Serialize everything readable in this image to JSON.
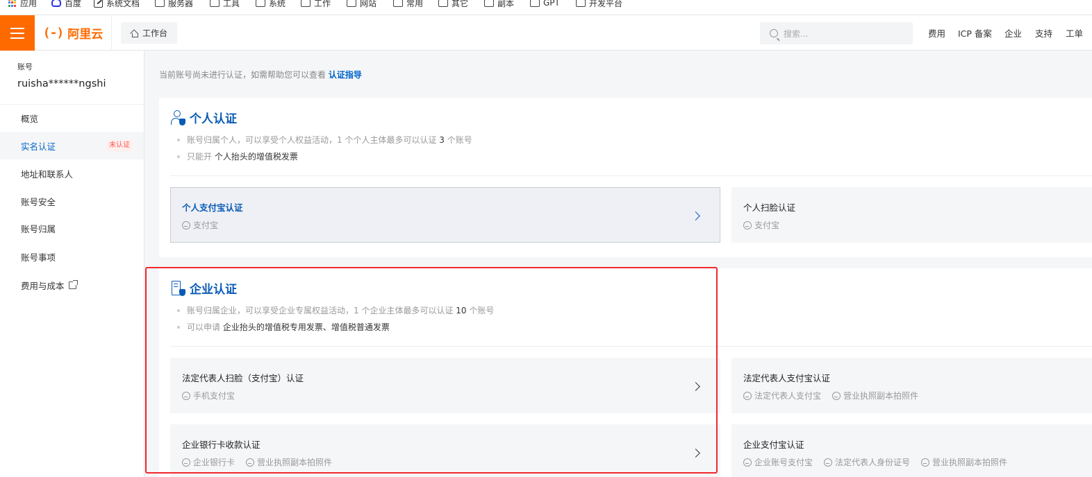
{
  "bookmarks": [
    {
      "label": "应用",
      "icon": "apps-icon"
    },
    {
      "label": "百度",
      "icon": "baidu-icon"
    },
    {
      "label": "系统文档",
      "icon": "doc-icon"
    },
    {
      "label": "服务器",
      "icon": "folder-icon"
    },
    {
      "label": "工具",
      "icon": "folder-icon"
    },
    {
      "label": "系统",
      "icon": "folder-icon"
    },
    {
      "label": "工作",
      "icon": "folder-icon"
    },
    {
      "label": "网站",
      "icon": "folder-icon"
    },
    {
      "label": "常用",
      "icon": "folder-icon"
    },
    {
      "label": "其它",
      "icon": "folder-icon"
    },
    {
      "label": "副本",
      "icon": "folder-icon"
    },
    {
      "label": "GPT",
      "icon": "folder-icon"
    },
    {
      "label": "开发平台",
      "icon": "folder-icon"
    }
  ],
  "header": {
    "logo_mark": "(-)",
    "logo_text": "阿里云",
    "workbench": "工作台",
    "search_placeholder": "搜索...",
    "nav": [
      "费用",
      "ICP 备案",
      "企业",
      "支持",
      "工单"
    ]
  },
  "sidebar": {
    "account_label": "账号",
    "account_name": "ruisha******ngshi",
    "items": [
      {
        "label": "概览"
      },
      {
        "label": "实名认证",
        "badge": "未认证"
      },
      {
        "label": "地址和联系人"
      },
      {
        "label": "账号安全"
      },
      {
        "label": "账号归属"
      },
      {
        "label": "账号事项"
      },
      {
        "label": "费用与成本"
      }
    ]
  },
  "notice": {
    "text": "当前账号尚未进行认证，如需帮助您可以查看",
    "link": "认证指导"
  },
  "personal": {
    "title": "个人认证",
    "bullet1_pre": "账号归属个人，可以享受个人权益活动，1 个个人主体最多可以认证",
    "bullet1_num": "3",
    "bullet1_post": "个账号",
    "bullet2_pre": "只能开",
    "bullet2_em": "个人抬头的增值税发票",
    "cards": [
      {
        "title": "个人支付宝认证",
        "subs": [
          "支付宝"
        ]
      },
      {
        "title": "个人扫脸认证",
        "subs": [
          "支付宝"
        ]
      }
    ]
  },
  "enterprise": {
    "title": "企业认证",
    "bullet1_pre": "账号归属企业，可以享受企业专属权益活动，1 个企业主体最多可以认证",
    "bullet1_num": "10",
    "bullet1_post": "个账号",
    "bullet2_pre": "可以申请",
    "bullet2_em": "企业抬头的增值税专用发票、增值税普通发票",
    "cards": [
      {
        "title": "法定代表人扫脸（支付宝）认证",
        "subs": [
          "手机支付宝"
        ]
      },
      {
        "title": "法定代表人支付宝认证",
        "subs": [
          "法定代表人支付宝",
          "营业执照副本拍照件"
        ]
      },
      {
        "title": "企业银行卡收款认证",
        "subs": [
          "企业银行卡",
          "营业执照副本拍照件"
        ]
      },
      {
        "title": "企业支付宝认证",
        "subs": [
          "企业账号支付宝",
          "法定代表人身份证号",
          "营业执照副本拍照件"
        ]
      }
    ]
  },
  "colors": {
    "brand": "#ff6a00",
    "link": "#0064c8",
    "highlight": "#f0282d"
  }
}
